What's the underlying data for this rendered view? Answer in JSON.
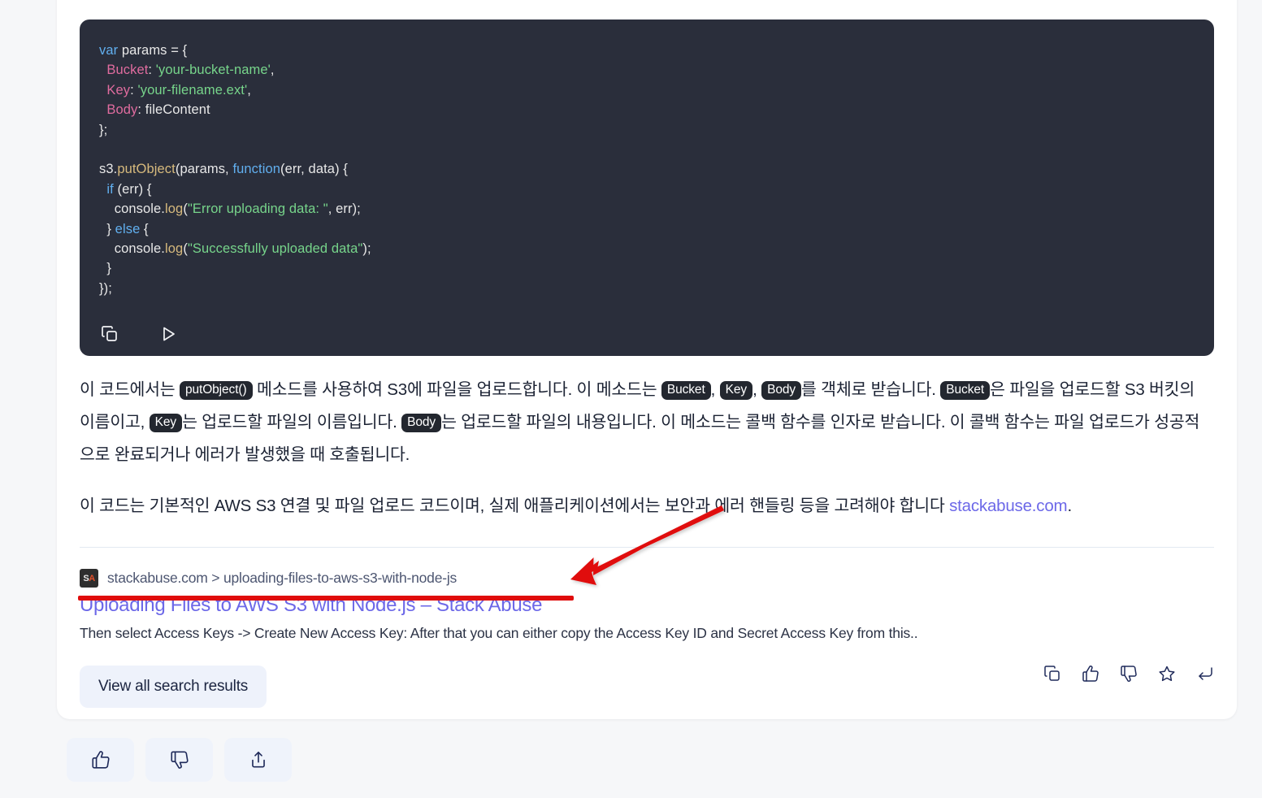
{
  "code_block": {
    "language": "javascript",
    "lines": [
      [
        {
          "t": "var ",
          "c": "tok-kw2"
        },
        {
          "t": "params = {",
          "c": "tok-plain"
        }
      ],
      [
        {
          "t": "  Bucket",
          "c": "tok-prop"
        },
        {
          "t": ": ",
          "c": "tok-plain"
        },
        {
          "t": "'your-bucket-name'",
          "c": "tok-str"
        },
        {
          "t": ",",
          "c": "tok-plain"
        }
      ],
      [
        {
          "t": "  Key",
          "c": "tok-prop"
        },
        {
          "t": ": ",
          "c": "tok-plain"
        },
        {
          "t": "'your-filename.ext'",
          "c": "tok-str"
        },
        {
          "t": ",",
          "c": "tok-plain"
        }
      ],
      [
        {
          "t": "  Body",
          "c": "tok-prop"
        },
        {
          "t": ": fileContent",
          "c": "tok-plain"
        }
      ],
      [
        {
          "t": "};",
          "c": "tok-plain"
        }
      ],
      [
        {
          "t": "",
          "c": "tok-plain"
        }
      ],
      [
        {
          "t": "s3.",
          "c": "tok-plain"
        },
        {
          "t": "putObject",
          "c": "tok-fn2"
        },
        {
          "t": "(params, ",
          "c": "tok-plain"
        },
        {
          "t": "function",
          "c": "tok-fn"
        },
        {
          "t": "(err, data) {",
          "c": "tok-plain"
        }
      ],
      [
        {
          "t": "  if",
          "c": "tok-fn"
        },
        {
          "t": " (err) {",
          "c": "tok-plain"
        }
      ],
      [
        {
          "t": "    console.",
          "c": "tok-plain"
        },
        {
          "t": "log",
          "c": "tok-fn2"
        },
        {
          "t": "(",
          "c": "tok-plain"
        },
        {
          "t": "\"Error uploading data: \"",
          "c": "tok-str"
        },
        {
          "t": ", err);",
          "c": "tok-plain"
        }
      ],
      [
        {
          "t": "  } ",
          "c": "tok-plain"
        },
        {
          "t": "else",
          "c": "tok-fn"
        },
        {
          "t": " {",
          "c": "tok-plain"
        }
      ],
      [
        {
          "t": "    console.",
          "c": "tok-plain"
        },
        {
          "t": "log",
          "c": "tok-fn2"
        },
        {
          "t": "(",
          "c": "tok-plain"
        },
        {
          "t": "\"Successfully uploaded data\"",
          "c": "tok-str"
        },
        {
          "t": ");",
          "c": "tok-plain"
        }
      ],
      [
        {
          "t": "  }",
          "c": "tok-plain"
        }
      ],
      [
        {
          "t": "});",
          "c": "tok-plain"
        }
      ]
    ],
    "actions": [
      {
        "name": "copy-code-icon",
        "label": "Copy code"
      },
      {
        "name": "run-code-icon",
        "label": "Run code"
      }
    ]
  },
  "paragraph_1": {
    "segments": [
      {
        "type": "text",
        "value": "이 코드에서는 "
      },
      {
        "type": "chip",
        "value": "putObject()"
      },
      {
        "type": "text",
        "value": " 메소드를 사용하여 S3에 파일을 업로드합니다. 이 메소드는 "
      },
      {
        "type": "chip",
        "value": "Bucket"
      },
      {
        "type": "text",
        "value": ", "
      },
      {
        "type": "chip",
        "value": "Key"
      },
      {
        "type": "text",
        "value": ", "
      },
      {
        "type": "chip",
        "value": "Body"
      },
      {
        "type": "text",
        "value": "를 객체로 받습니다. "
      },
      {
        "type": "chip",
        "value": "Bucket"
      },
      {
        "type": "text",
        "value": "은 파일을 업로드할 S3 버킷의 이름이고, "
      },
      {
        "type": "chip",
        "value": "Key"
      },
      {
        "type": "text",
        "value": "는 업로드할 파일의 이름입니다. "
      },
      {
        "type": "chip",
        "value": "Body"
      },
      {
        "type": "text",
        "value": "는 업로드할 파일의 내용입니다. 이 메소드는 콜백 함수를 인자로 받습니다. 이 콜백 함수는 파일 업로드가 성공적으로 완료되거나 에러가 발생했을 때 호출됩니다."
      }
    ]
  },
  "paragraph_2": {
    "segments": [
      {
        "type": "text",
        "value": "이 코드는 기본적인 AWS S3 연결 및 파일 업로드 코드이며, 실제 애플리케이션에서는 보안과 에러 핸들링 등을 고려해야 합니다 "
      },
      {
        "type": "link",
        "value": "stackabuse.com"
      },
      {
        "type": "text",
        "value": "."
      }
    ]
  },
  "citation": {
    "favicon": {
      "letter_1": "S",
      "letter_2": "A",
      "bg": "#2e2e2e",
      "accent": "#e2502a"
    },
    "url_path": "stackabuse.com > uploading-files-to-aws-s3-with-node-js",
    "title": "Uploading Files to AWS S3 with Node.js – Stack Abuse",
    "snippet": "Then select Access Keys -> Create New Access Key: After that you can either copy the Access Key ID and Secret Access Key from this..",
    "title_color": "#6c68e8"
  },
  "view_all_button": {
    "label": "View all search results"
  },
  "reaction_icons": [
    {
      "name": "copy-icon",
      "label": "Copy"
    },
    {
      "name": "thumbs-up-icon",
      "label": "Good response"
    },
    {
      "name": "thumbs-down-icon",
      "label": "Bad response"
    },
    {
      "name": "star-icon",
      "label": "Save"
    },
    {
      "name": "reply-icon",
      "label": "Regenerate"
    }
  ],
  "bottom_buttons": [
    {
      "name": "thumbs-up-button",
      "label": "Like"
    },
    {
      "name": "thumbs-down-button",
      "label": "Dislike"
    },
    {
      "name": "share-button",
      "label": "Share"
    }
  ],
  "annotation": {
    "arrow_color": "#e00c0c",
    "underline_color": "#e00c0c"
  }
}
